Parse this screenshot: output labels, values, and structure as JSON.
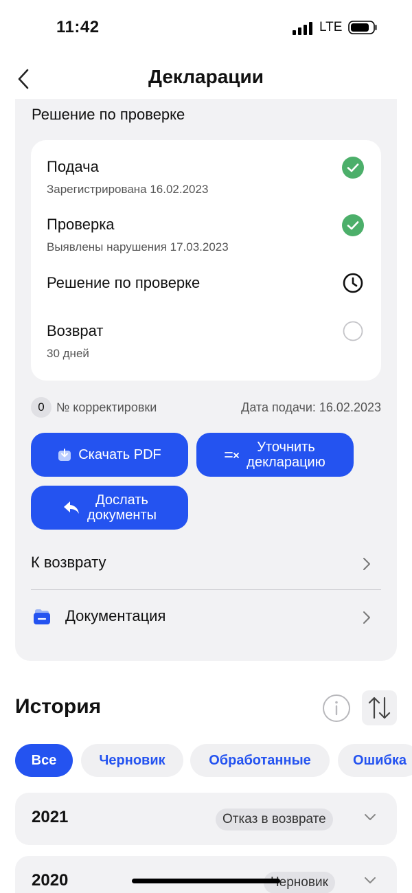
{
  "status_bar": {
    "time": "11:42",
    "network": "LTE"
  },
  "nav": {
    "title": "Декларации"
  },
  "decision": {
    "section_title": "Решение по проверке",
    "steps": [
      {
        "title": "Подача",
        "subtitle": "Зарегистрирована 16.02.2023",
        "status": "done"
      },
      {
        "title": "Проверка",
        "subtitle": "Выявлены нарушения 17.03.2023",
        "status": "done"
      },
      {
        "title": "Решение по проверке",
        "subtitle": "",
        "status": "in-progress"
      },
      {
        "title": "Возврат",
        "subtitle": "30 дней",
        "status": "pending"
      }
    ],
    "correction_count": "0",
    "correction_label": "№ корректировки",
    "submit_date": "Дата подачи: 16.02.2023",
    "buttons": {
      "download_pdf": "Скачать PDF",
      "clarify_line1": "Уточнить",
      "clarify_line2": "декларацию",
      "send_line1": "Дослать",
      "send_line2": "документы"
    },
    "links": {
      "refund": "К возврату",
      "documentation": "Документация"
    }
  },
  "history": {
    "title": "История",
    "filters": [
      "Все",
      "Черновик",
      "Обработанные",
      "Ошибка"
    ],
    "active_filter": "Все",
    "years": [
      {
        "year": "2021",
        "status": "Отказ в возврате"
      },
      {
        "year": "2020",
        "status": "Черновик"
      }
    ]
  },
  "colors": {
    "accent": "#2453f0",
    "success": "#4caf6a",
    "background_card": "#f2f2f4"
  }
}
